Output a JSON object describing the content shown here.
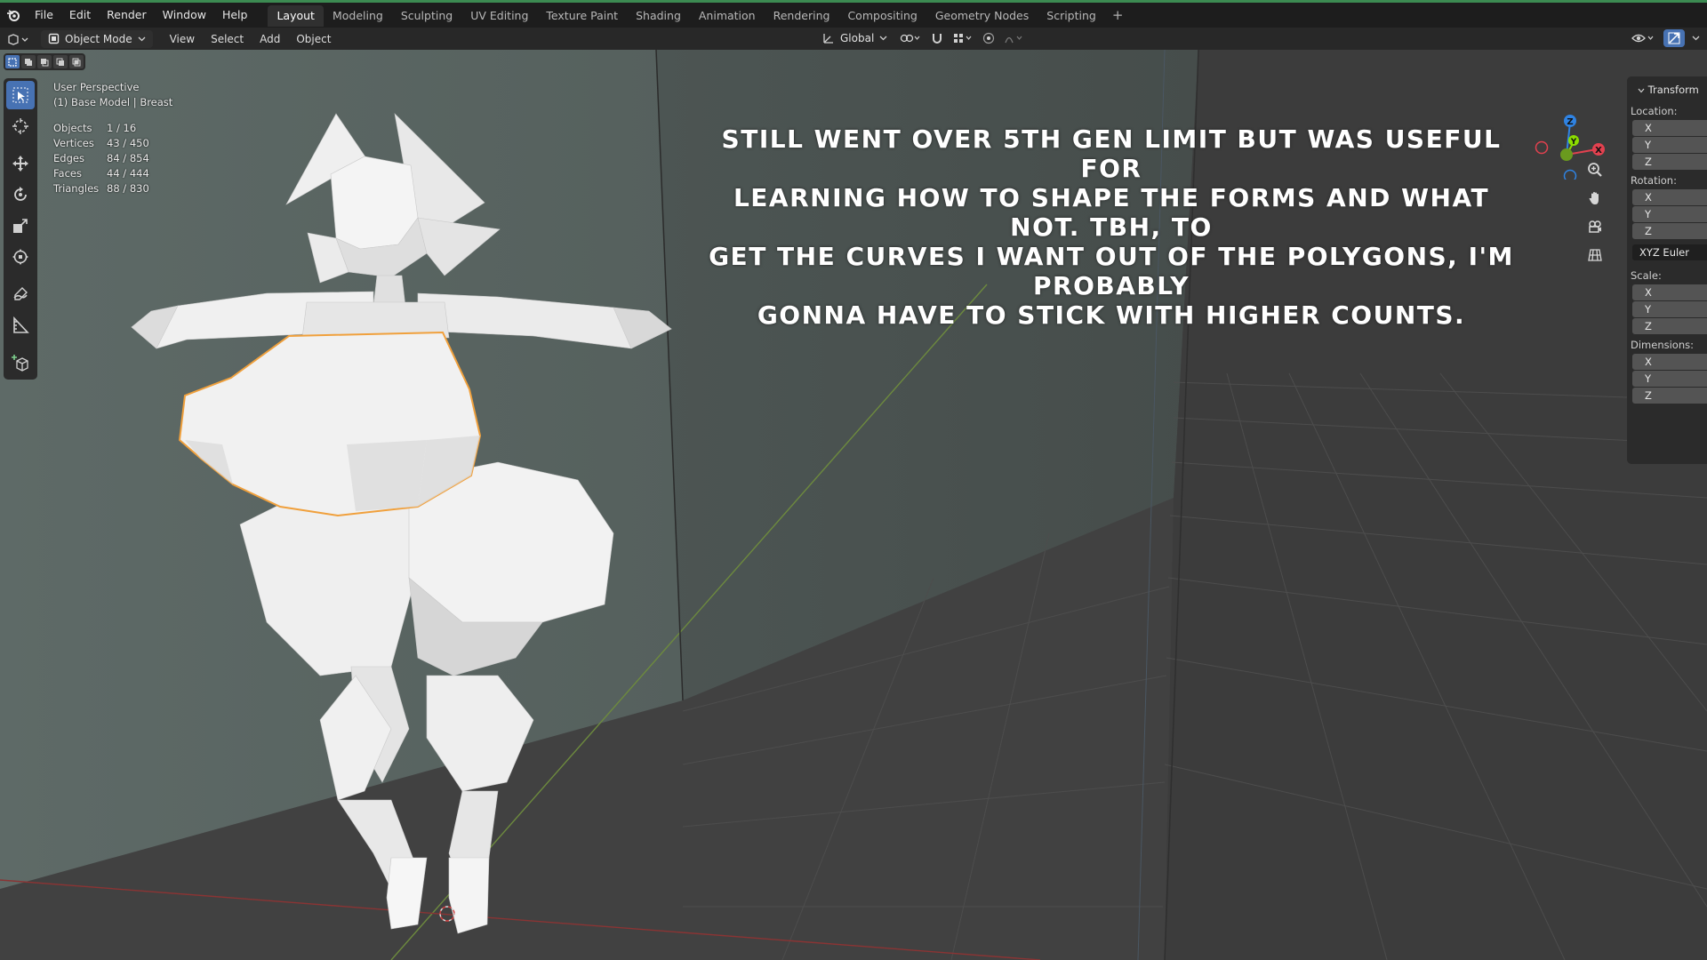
{
  "menubar": {
    "items": [
      "File",
      "Edit",
      "Render",
      "Window",
      "Help"
    ],
    "workspaces": [
      "Layout",
      "Modeling",
      "Sculpting",
      "UV Editing",
      "Texture Paint",
      "Shading",
      "Animation",
      "Rendering",
      "Compositing",
      "Geometry Nodes",
      "Scripting"
    ],
    "active_workspace": "Layout",
    "add_tab": "+"
  },
  "header": {
    "mode": "Object Mode",
    "menus": [
      "View",
      "Select",
      "Add",
      "Object"
    ],
    "transform_orientation": "Global"
  },
  "viewport": {
    "view_name": "User Perspective",
    "object_path": "(1) Base Model | Breast",
    "stats": [
      {
        "label": "Objects",
        "value": "1 / 16"
      },
      {
        "label": "Vertices",
        "value": "43 / 450"
      },
      {
        "label": "Edges",
        "value": "84 / 854"
      },
      {
        "label": "Faces",
        "value": "44 / 444"
      },
      {
        "label": "Triangles",
        "value": "88 / 830"
      }
    ],
    "comment_lines": [
      "Still went over 5th gen limit but was useful for",
      "learning how to shape the forms and what not. tbh, to",
      "get the curves I want out of the polygons, I'm probably",
      "gonna have to stick with higher counts."
    ]
  },
  "gizmo": {
    "z": "Z",
    "x": "X",
    "y": "Y"
  },
  "sidebar": {
    "title": "Transform",
    "location_label": "Location:",
    "rotation_label": "Rotation:",
    "rotation_mode": "XYZ Euler",
    "scale_label": "Scale:",
    "dimensions_label": "Dimensions:",
    "axes": [
      "X",
      "Y",
      "Z"
    ]
  },
  "colors": {
    "accent": "#4772b3",
    "selection_outline": "#f0a03c",
    "x_axis": "#e2414f",
    "y_axis": "#8bdc00",
    "z_axis": "#2f83e3"
  }
}
